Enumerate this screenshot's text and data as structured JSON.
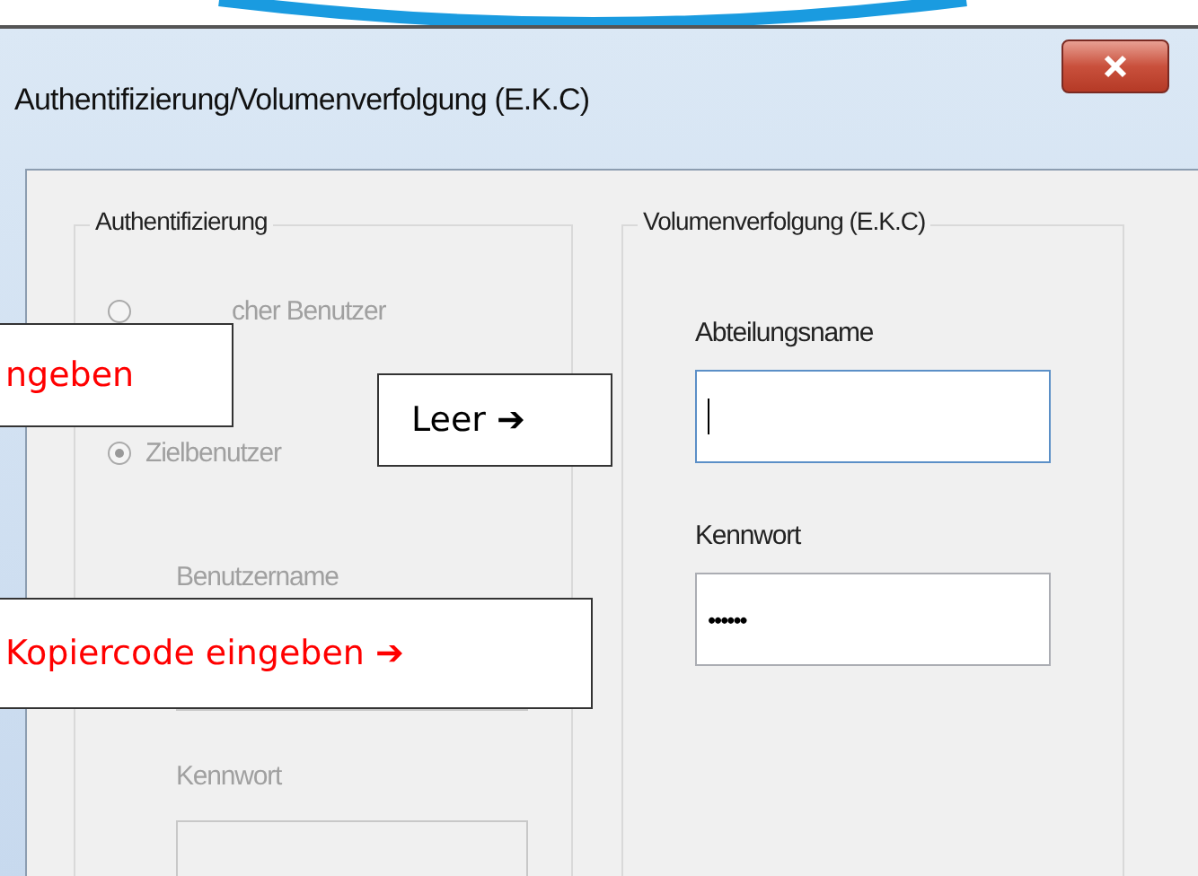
{
  "window": {
    "title": "Authentifizierung/Volumenverfolgung (E.K.C)"
  },
  "authentication": {
    "title": "Authentifizierung",
    "disabled": true,
    "options": [
      {
        "label": "cher Benutzer",
        "selected": false
      },
      {
        "label": "Zielbenutzer",
        "selected": true
      }
    ],
    "fields": [
      {
        "label": "Benutzername"
      },
      {
        "label": "Kennwort"
      }
    ]
  },
  "volume_tracking": {
    "title": "Volumenverfolgung (E.K.C)",
    "fields": [
      {
        "label": "Abteilungsname",
        "focused": true
      },
      {
        "label": "Kennwort",
        "value": "••••••",
        "focused": false
      }
    ]
  },
  "callouts": [
    {
      "text": "ngeben",
      "color": "#ff0000"
    },
    {
      "text": "Leer",
      "arrow": "➔",
      "color": "#000000"
    },
    {
      "text": "Kopiercode eingeben",
      "arrow": "➔",
      "color": "#ff0000"
    }
  ]
}
